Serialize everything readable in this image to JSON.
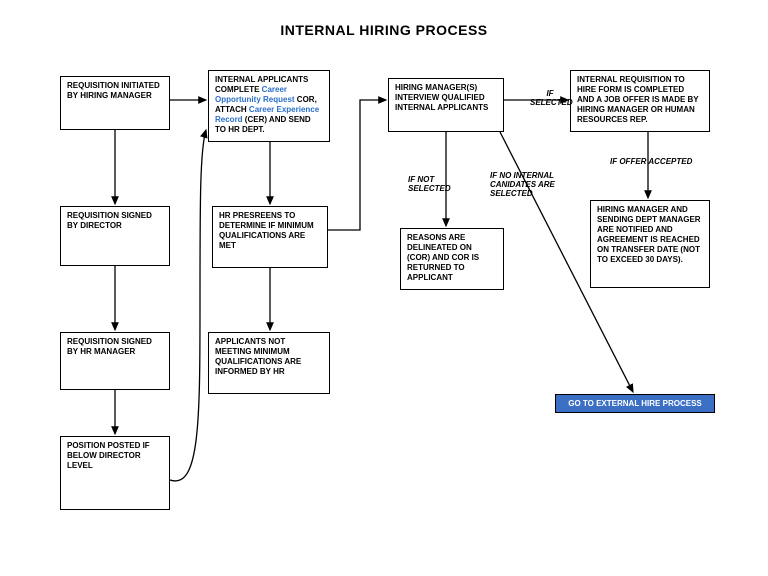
{
  "title": "INTERNAL HIRING PROCESS",
  "col1": {
    "b1": "REQUISITION INITIATED BY HIRING MANAGER",
    "b2": "REQUISITION SIGNED BY DIRECTOR",
    "b3": "REQUISITION SIGNED BY HR MANAGER",
    "b4": "POSITION POSTED IF BELOW DIRECTOR LEVEL"
  },
  "col2": {
    "b1_pre": "INTERNAL APPLICANTS COMPLETE ",
    "b1_link1": "Career Opportunity Request",
    "b1_mid": " COR, ATTACH ",
    "b1_link2": "Career Experience Record",
    "b1_post": " (CER) AND SEND TO HR DEPT.",
    "b2": "HR PRESREENS TO DETERMINE IF MINIMUM QUALIFICATIONS ARE MET",
    "b3": "APPLICANTS NOT MEETING MINIMUM QUALIFICATIONS ARE INFORMED BY HR"
  },
  "col3": {
    "b1": "HIRING MANAGER(S) INTERVIEW QUALIFIED INTERNAL APPLICANTS",
    "b2": "REASONS ARE DELINEATED ON (COR) AND COR IS RETURNED TO APPLICANT"
  },
  "col4": {
    "b1": "INTERNAL REQUISITION TO HIRE FORM IS COMPLETED AND A JOB OFFER IS MADE BY HIRING MANAGER OR HUMAN RESOURCES REP.",
    "b2": "HIRING MANAGER AND SENDING DEPT MANAGER ARE NOTIFIED AND AGREEMENT IS REACHED ON TRANSFER DATE (NOT TO EXCEED 30 DAYS)."
  },
  "labels": {
    "if_selected": "IF SELECTED",
    "if_not_selected": "IF  NOT SELECTED",
    "if_no_internal": "IF  NO INTERNAL CANIDATES ARE SELECTED",
    "if_offer_accepted": "IF OFFER ACCEPTED"
  },
  "action": "GO TO EXTERNAL HIRE PROCESS"
}
